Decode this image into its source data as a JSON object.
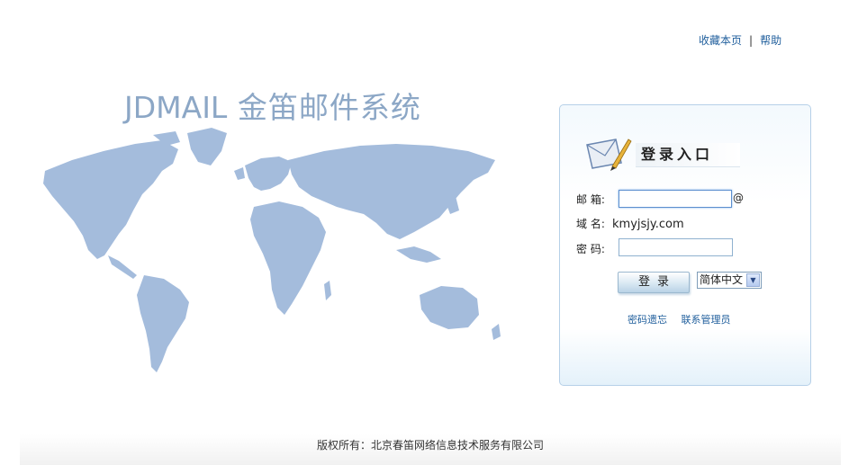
{
  "top_links": {
    "bookmark": "收藏本页",
    "separator": "|",
    "help": "帮助"
  },
  "brand": {
    "en": "JDMAIL",
    "cn": "金笛邮件系统",
    "color": "#8ca7c6"
  },
  "login": {
    "title": "登录入口",
    "email_label": "邮 箱:",
    "email_value": "",
    "at_sign": "@",
    "domain_label": "域 名:",
    "domain_value": "kmyjsjy.com",
    "password_label": "密 码:",
    "password_value": "",
    "submit_label": "登录",
    "language_selected": "简体中文",
    "forgot_password": "密码遗忘",
    "contact_admin": "联系管理员"
  },
  "footer": {
    "copyright": "版权所有：北京春笛网络信息技术服务有限公司"
  },
  "colors": {
    "accent": "#1f5e9c",
    "panel_border": "#b6d0e8",
    "map": "#9fb8d8"
  }
}
